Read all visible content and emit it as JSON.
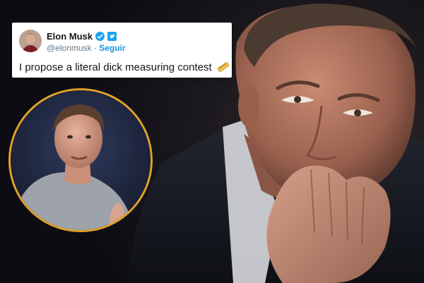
{
  "tweet": {
    "display_name": "Elon Musk",
    "handle": "@elonmusk",
    "separator": " · ",
    "follow_label": "Seguir",
    "text": "I propose a literal dick measuring contest",
    "emoji_icon": "ruler-icon",
    "verified_icon": "verified-badge-icon",
    "platform_icon": "twitter-bird-icon"
  },
  "colors": {
    "card_background": "#ffffff",
    "follow_link": "#1b95e0",
    "verified_badge": "#1da1f2",
    "circle_border": "#e2a12a",
    "background": "#0b0b10"
  }
}
